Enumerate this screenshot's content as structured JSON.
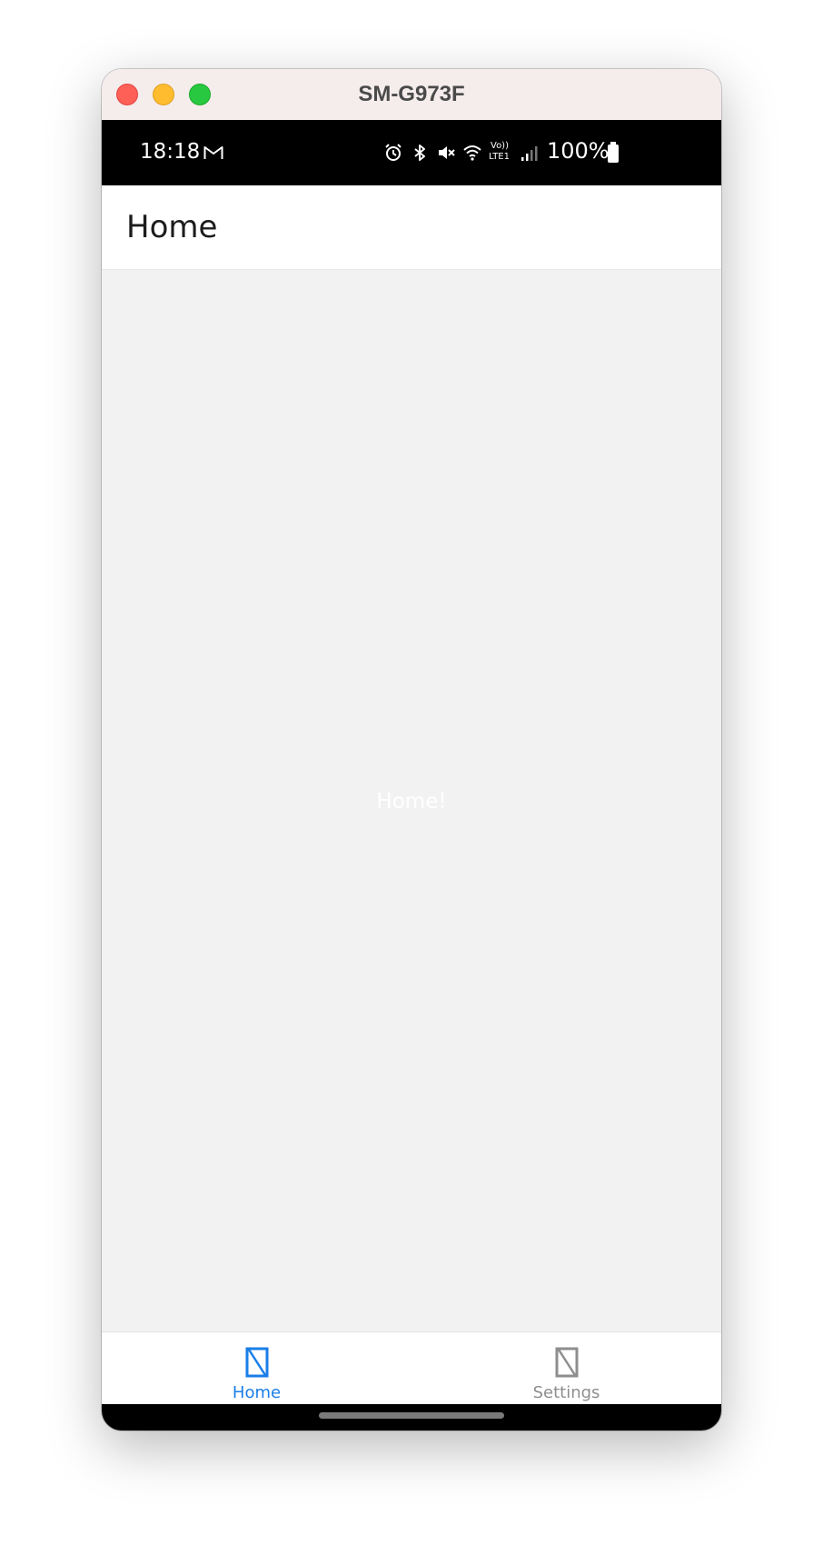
{
  "window": {
    "title": "SM-G973F"
  },
  "status_bar": {
    "time": "18:18",
    "notification_icon": "gmail-icon",
    "system_icons": [
      "alarm-icon",
      "bluetooth-icon",
      "mute-icon",
      "wifi-icon",
      "volte-lte-icon",
      "signal-icon"
    ],
    "volte_label": "Vo))",
    "lte_label": "LTE1",
    "battery_text": "100%",
    "battery_icon": "battery-icon"
  },
  "header": {
    "title": "Home"
  },
  "content": {
    "text": "Home!"
  },
  "tabs": [
    {
      "label": "Home",
      "icon": "tab-placeholder-icon",
      "active": true
    },
    {
      "label": "Settings",
      "icon": "tab-placeholder-icon",
      "active": false
    }
  ],
  "colors": {
    "active_tab": "#1a7ee8",
    "inactive_tab": "#8e8e8e",
    "content_bg": "#f2f2f2",
    "titlebar_bg": "#f5ecec"
  }
}
